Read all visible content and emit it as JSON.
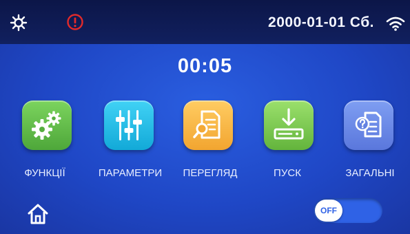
{
  "status_bar": {
    "date": "2000-01-01 Сб.",
    "icons": [
      "settings-gear-icon",
      "alert-icon",
      "wifi-icon"
    ],
    "alert_color": "#e22a2a"
  },
  "timer": "00:05",
  "menu": [
    {
      "label": "ФУНКЦІЇ",
      "icon": "gears-icon",
      "color": "#5cbb45"
    },
    {
      "label": "ПАРАМЕТРИ",
      "icon": "sliders-icon",
      "color": "#1ebce6"
    },
    {
      "label": "ПЕРЕГЛЯД",
      "icon": "document-search-icon",
      "color": "#f6b43e"
    },
    {
      "label": "ПУСК",
      "icon": "download-tray-icon",
      "color": "#77c84d"
    },
    {
      "label": "ЗАГАЛЬНІ",
      "icon": "document-question-icon",
      "color": "#6886e6"
    }
  ],
  "footer": {
    "home_icon": "home-icon",
    "toggle": {
      "label": "OFF",
      "state": "off"
    }
  }
}
